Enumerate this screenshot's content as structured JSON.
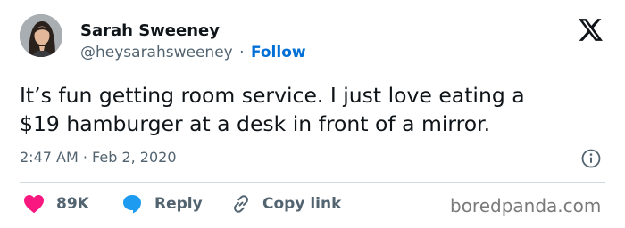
{
  "tweet": {
    "author_name": "Sarah Sweeney",
    "handle": "@heysarahsweeney",
    "separator": "·",
    "follow_label": "Follow",
    "text_line1": "It’s fun getting room service. I just love eating a",
    "text_line2": "$19 hamburger at a desk in front of a mirror.",
    "timestamp": "2:47 AM · Feb 2, 2020"
  },
  "actions": {
    "like_count": "89K",
    "reply_label": "Reply",
    "copy_label": "Copy link"
  },
  "icons": {
    "platform_logo": "x-logo-icon",
    "info": "info-icon",
    "like": "heart-icon",
    "reply": "speech-bubble-icon",
    "copy": "link-icon"
  },
  "watermark": "boredpanda.com",
  "colors": {
    "accent": "#006fd6",
    "like": "#f91880",
    "reply": "#1d9bf0",
    "muted": "#536471",
    "text": "#0f1419"
  }
}
